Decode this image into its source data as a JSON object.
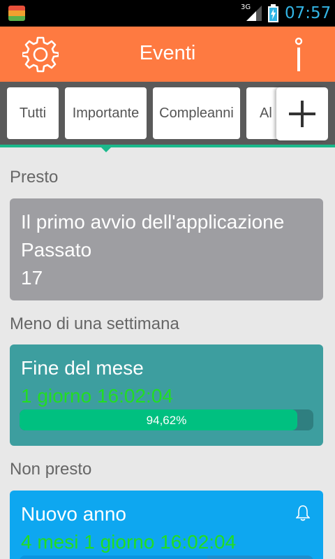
{
  "status_bar": {
    "network": "3G",
    "time": "07:57",
    "time_color": "#33b5e5"
  },
  "app_bar": {
    "title": "Eventi",
    "color": "#fe7a41",
    "settings_icon": "gear-icon",
    "info_icon": "info-icon"
  },
  "tabs": [
    {
      "label": "Tutti"
    },
    {
      "label": "Importante"
    },
    {
      "label": "Compleanni"
    },
    {
      "label": "Al"
    }
  ],
  "add_tab_icon": "plus-icon",
  "sections": {
    "soon": "Presto",
    "week": "Meno di una settimana",
    "not_soon": "Non presto"
  },
  "events": [
    {
      "title": "Il primo avvio dell'applicazione",
      "status": "Passato",
      "count": "17",
      "color": "#9e9ea2"
    },
    {
      "title": "Fine del mese",
      "countdown": "1 giorno 16:02:04",
      "progress_label": "94,62%",
      "progress": 0.9462,
      "color": "#3d9e9f"
    },
    {
      "title": "Nuovo anno",
      "countdown": "4 mesi 1 giorno 16:02:04",
      "bell_icon": "bell-icon",
      "color": "#0ea7f0"
    }
  ],
  "colors": {
    "countdown_text": "#22dd22",
    "progress_fill": "#00c080",
    "tab_indicator": "#1bb98c"
  }
}
